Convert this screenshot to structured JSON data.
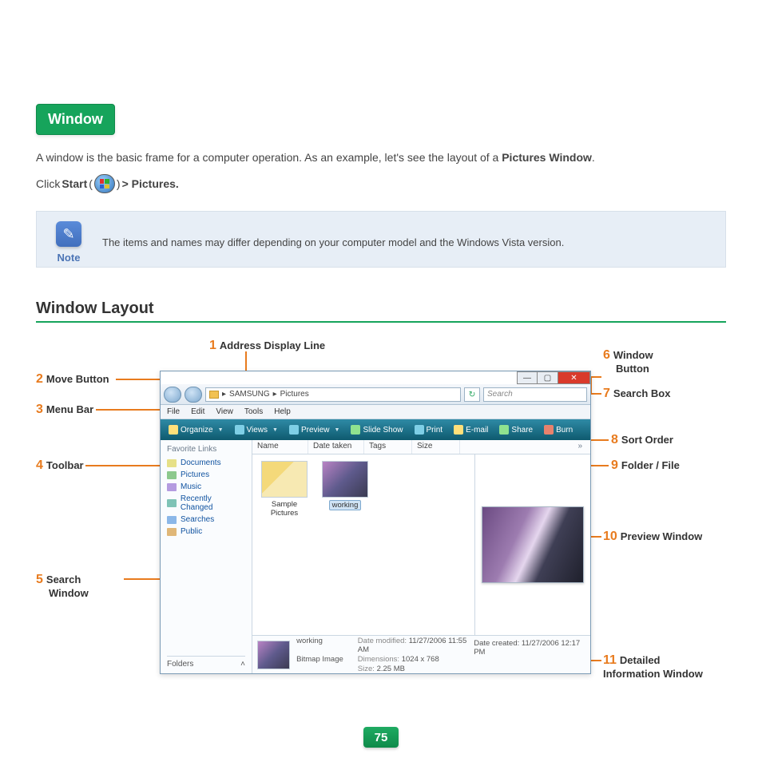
{
  "badge": "Window",
  "intro_before": "A window is the basic frame for a computer operation. As an example, let's see the layout of a ",
  "intro_bold": "Pictures Window",
  "intro_after": ".",
  "click_prefix": "Click ",
  "click_start": "Start",
  "click_paren_open": "(",
  "click_paren_close": ")",
  "click_suffix": " > Pictures.",
  "note_label": "Note",
  "note_text": "The items and names may differ depending on your computer model and the Windows Vista version.",
  "section_title": "Window Layout",
  "callouts": {
    "c1": "Address Display Line",
    "c2": "Move Button",
    "c3": "Menu Bar",
    "c4": "Toolbar",
    "c5_a": "Search",
    "c5_b": "Window",
    "c6_a": "Window",
    "c6_b": "Button",
    "c7": "Search Box",
    "c8": "Sort Order",
    "c9": "Folder / File",
    "c10": "Preview Window",
    "c11_a": "Detailed",
    "c11_b": "Information Window"
  },
  "explorer": {
    "breadcrumb": {
      "seg1": "SAMSUNG",
      "seg2": "Pictures",
      "sep": "▸"
    },
    "search_placeholder": "Search",
    "menu": [
      "File",
      "Edit",
      "View",
      "Tools",
      "Help"
    ],
    "toolbar": [
      "Organize",
      "Views",
      "Preview",
      "Slide Show",
      "Print",
      "E-mail",
      "Share",
      "Burn"
    ],
    "sidebar_header": "Favorite Links",
    "sidebar": [
      "Documents",
      "Pictures",
      "Music",
      "Recently Changed",
      "Searches",
      "Public"
    ],
    "folders_label": "Folders",
    "columns": [
      "Name",
      "Date taken",
      "Tags",
      "Size"
    ],
    "col_more": "»",
    "items": [
      {
        "label": "Sample Pictures"
      },
      {
        "label": "working"
      }
    ],
    "details": {
      "name": "working",
      "type": "Bitmap Image",
      "modified_label": "Date modified:",
      "modified": "11/27/2006 11:55 AM",
      "dim_label": "Dimensions:",
      "dim": "1024 x 768",
      "size_label": "Size:",
      "size": "2.25 MB",
      "created_label": "Date created:",
      "created": "11/27/2006 12:17 PM"
    }
  },
  "page_number": "75"
}
